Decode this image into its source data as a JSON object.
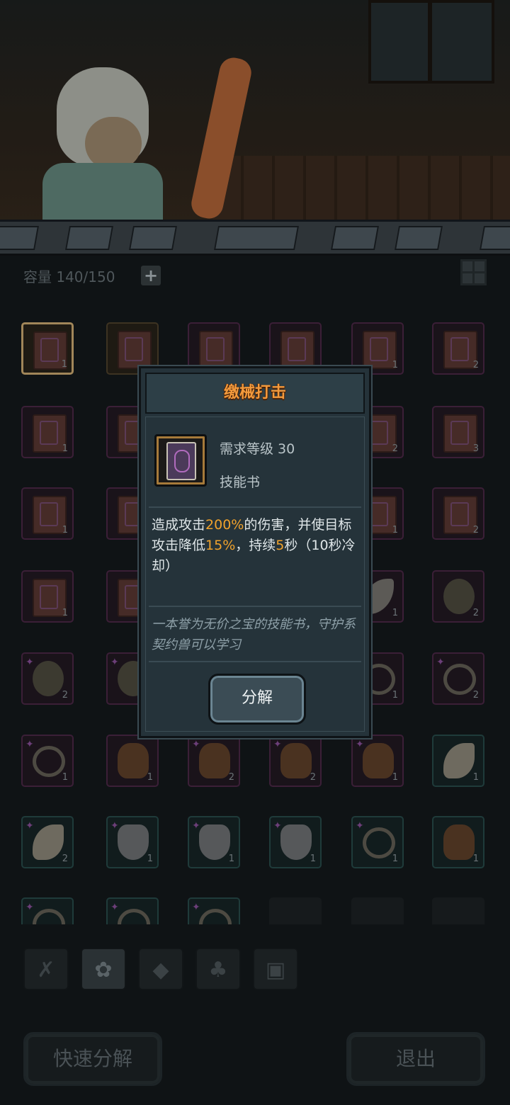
{
  "header": {
    "capacity_text": "容量 140/150",
    "add_capacity_icon": "plus-icon",
    "view_toggle_icon": "grid-icon"
  },
  "inventory": {
    "slots": [
      {
        "type": "book",
        "frame": "gold",
        "count": "1",
        "selected": true
      },
      {
        "type": "book",
        "frame": "gold",
        "count": ""
      },
      {
        "type": "book",
        "frame": "purple",
        "count": ""
      },
      {
        "type": "book",
        "frame": "purple",
        "count": ""
      },
      {
        "type": "book",
        "frame": "purple",
        "count": "1"
      },
      {
        "type": "book",
        "frame": "purple",
        "count": "2"
      },
      {
        "type": "book",
        "frame": "purple",
        "count": "1"
      },
      {
        "type": "book",
        "frame": "purple",
        "count": ""
      },
      {
        "type": "hidden",
        "frame": "purple",
        "count": ""
      },
      {
        "type": "hidden",
        "frame": "purple",
        "count": ""
      },
      {
        "type": "book",
        "frame": "purple",
        "count": "2"
      },
      {
        "type": "book",
        "frame": "purple",
        "count": "3"
      },
      {
        "type": "book",
        "frame": "purple",
        "count": "1"
      },
      {
        "type": "book",
        "frame": "purple",
        "count": ""
      },
      {
        "type": "hidden",
        "frame": "purple",
        "count": ""
      },
      {
        "type": "hidden",
        "frame": "purple",
        "count": ""
      },
      {
        "type": "book",
        "frame": "purple",
        "count": "1"
      },
      {
        "type": "book",
        "frame": "purple",
        "count": "2"
      },
      {
        "type": "book",
        "frame": "purple",
        "count": "1"
      },
      {
        "type": "book",
        "frame": "purple",
        "count": ""
      },
      {
        "type": "hidden",
        "frame": "purple",
        "count": ""
      },
      {
        "type": "hidden",
        "frame": "purple",
        "count": ""
      },
      {
        "type": "claw",
        "frame": "purple",
        "count": "1"
      },
      {
        "type": "orb",
        "frame": "purple",
        "count": "2"
      },
      {
        "type": "orb",
        "frame": "purple",
        "count": "2",
        "spark": true
      },
      {
        "type": "orb",
        "frame": "purple",
        "count": "",
        "spark": true
      },
      {
        "type": "hidden",
        "frame": "purple",
        "count": ""
      },
      {
        "type": "hidden",
        "frame": "purple",
        "count": ""
      },
      {
        "type": "collar",
        "frame": "purple",
        "count": "1"
      },
      {
        "type": "collar",
        "frame": "purple",
        "count": "2",
        "spark": true
      },
      {
        "type": "collar",
        "frame": "purple",
        "count": "1",
        "spark": true
      },
      {
        "type": "bell",
        "frame": "purple",
        "count": "1"
      },
      {
        "type": "bell",
        "frame": "purple",
        "count": "2",
        "spark": true
      },
      {
        "type": "bell",
        "frame": "purple",
        "count": "2",
        "spark": true
      },
      {
        "type": "bell",
        "frame": "purple",
        "count": "1",
        "spark": true
      },
      {
        "type": "fang",
        "frame": "teal",
        "count": "1"
      },
      {
        "type": "fang",
        "frame": "teal",
        "count": "2",
        "spark": true
      },
      {
        "type": "fur",
        "frame": "teal",
        "count": "1",
        "spark": true
      },
      {
        "type": "fur",
        "frame": "teal",
        "count": "1",
        "spark": true
      },
      {
        "type": "fur",
        "frame": "teal",
        "count": "1",
        "spark": true
      },
      {
        "type": "collar",
        "frame": "teal",
        "count": "1",
        "spark": true
      },
      {
        "type": "bell",
        "frame": "teal",
        "count": "1"
      },
      {
        "type": "collar",
        "frame": "teal",
        "count": "",
        "spark": true
      },
      {
        "type": "collar",
        "frame": "teal",
        "count": "",
        "spark": true
      },
      {
        "type": "collar",
        "frame": "teal",
        "count": "",
        "spark": true
      },
      {
        "type": "empty",
        "frame": "empty",
        "count": ""
      },
      {
        "type": "empty",
        "frame": "empty",
        "count": ""
      },
      {
        "type": "empty",
        "frame": "empty",
        "count": ""
      }
    ]
  },
  "tabs": [
    {
      "icon": "wing-icon",
      "glyph": "✗",
      "active": false
    },
    {
      "icon": "paw-icon",
      "glyph": "✿",
      "active": true
    },
    {
      "icon": "gem-icon",
      "glyph": "◆",
      "active": false
    },
    {
      "icon": "leaf-icon",
      "glyph": "♣",
      "active": false
    },
    {
      "icon": "chest-icon",
      "glyph": "▣",
      "active": false
    }
  ],
  "buttons": {
    "quick_decompose": "快速分解",
    "exit": "退出"
  },
  "popup": {
    "title": "缴械打击",
    "required_level": "需求等级 30",
    "item_type": "技能书",
    "desc_part1": "造成攻击",
    "desc_val1": "200%",
    "desc_part2": "的伤害，并使目标攻击降低",
    "desc_val2": "15%",
    "desc_part3": "，持续",
    "desc_val3": "5",
    "desc_part4": "秒（10秒冷却）",
    "flavor": "一本誉为无价之宝的技能书，守护系契约兽可以学习",
    "decompose_label": "分解"
  },
  "colors": {
    "highlight": "#f0a22c",
    "title": "#f29a3d",
    "panel": "#25333a"
  }
}
